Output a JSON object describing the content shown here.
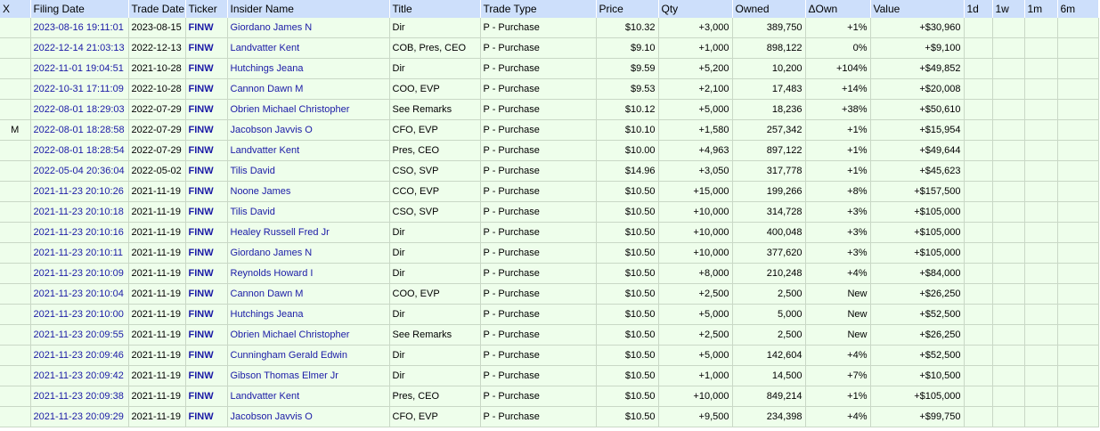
{
  "headers": {
    "x": "X",
    "filing_date": "Filing Date",
    "trade_date": "Trade Date",
    "ticker": "Ticker",
    "insider_name": "Insider Name",
    "title": "Title",
    "trade_type": "Trade Type",
    "price": "Price",
    "qty": "Qty",
    "owned": "Owned",
    "own_change": "ΔOwn",
    "value": "Value",
    "d1": "1d",
    "w1": "1w",
    "m1": "1m",
    "m6": "6m"
  },
  "rows": [
    {
      "x": "",
      "filing": "2023-08-16 19:11:01",
      "trade": "2023-08-15",
      "ticker": "FINW",
      "name": "Giordano James N",
      "title": "Dir",
      "type": "P - Purchase",
      "price": "$10.32",
      "qty": "+3,000",
      "owned": "389,750",
      "own": "+1%",
      "value": "+$30,960"
    },
    {
      "x": "",
      "filing": "2022-12-14 21:03:13",
      "trade": "2022-12-13",
      "ticker": "FINW",
      "name": "Landvatter Kent",
      "title": "COB, Pres, CEO",
      "type": "P - Purchase",
      "price": "$9.10",
      "qty": "+1,000",
      "owned": "898,122",
      "own": "0%",
      "value": "+$9,100"
    },
    {
      "x": "",
      "filing": "2022-11-01 19:04:51",
      "trade": "2021-10-28",
      "ticker": "FINW",
      "name": "Hutchings Jeana",
      "title": "Dir",
      "type": "P - Purchase",
      "price": "$9.59",
      "qty": "+5,200",
      "owned": "10,200",
      "own": "+104%",
      "value": "+$49,852"
    },
    {
      "x": "",
      "filing": "2022-10-31 17:11:09",
      "trade": "2022-10-28",
      "ticker": "FINW",
      "name": "Cannon Dawn M",
      "title": "COO, EVP",
      "type": "P - Purchase",
      "price": "$9.53",
      "qty": "+2,100",
      "owned": "17,483",
      "own": "+14%",
      "value": "+$20,008"
    },
    {
      "x": "",
      "filing": "2022-08-01 18:29:03",
      "trade": "2022-07-29",
      "ticker": "FINW",
      "name": "Obrien Michael Christopher",
      "title": "See Remarks",
      "type": "P - Purchase",
      "price": "$10.12",
      "qty": "+5,000",
      "owned": "18,236",
      "own": "+38%",
      "value": "+$50,610"
    },
    {
      "x": "M",
      "filing": "2022-08-01 18:28:58",
      "trade": "2022-07-29",
      "ticker": "FINW",
      "name": "Jacobson Javvis O",
      "title": "CFO, EVP",
      "type": "P - Purchase",
      "price": "$10.10",
      "qty": "+1,580",
      "owned": "257,342",
      "own": "+1%",
      "value": "+$15,954"
    },
    {
      "x": "",
      "filing": "2022-08-01 18:28:54",
      "trade": "2022-07-29",
      "ticker": "FINW",
      "name": "Landvatter Kent",
      "title": "Pres, CEO",
      "type": "P - Purchase",
      "price": "$10.00",
      "qty": "+4,963",
      "owned": "897,122",
      "own": "+1%",
      "value": "+$49,644"
    },
    {
      "x": "",
      "filing": "2022-05-04 20:36:04",
      "trade": "2022-05-02",
      "ticker": "FINW",
      "name": "Tilis David",
      "title": "CSO, SVP",
      "type": "P - Purchase",
      "price": "$14.96",
      "qty": "+3,050",
      "owned": "317,778",
      "own": "+1%",
      "value": "+$45,623"
    },
    {
      "x": "",
      "filing": "2021-11-23 20:10:26",
      "trade": "2021-11-19",
      "ticker": "FINW",
      "name": "Noone James",
      "title": "CCO, EVP",
      "type": "P - Purchase",
      "price": "$10.50",
      "qty": "+15,000",
      "owned": "199,266",
      "own": "+8%",
      "value": "+$157,500"
    },
    {
      "x": "",
      "filing": "2021-11-23 20:10:18",
      "trade": "2021-11-19",
      "ticker": "FINW",
      "name": "Tilis David",
      "title": "CSO, SVP",
      "type": "P - Purchase",
      "price": "$10.50",
      "qty": "+10,000",
      "owned": "314,728",
      "own": "+3%",
      "value": "+$105,000"
    },
    {
      "x": "",
      "filing": "2021-11-23 20:10:16",
      "trade": "2021-11-19",
      "ticker": "FINW",
      "name": "Healey Russell Fred Jr",
      "title": "Dir",
      "type": "P - Purchase",
      "price": "$10.50",
      "qty": "+10,000",
      "owned": "400,048",
      "own": "+3%",
      "value": "+$105,000"
    },
    {
      "x": "",
      "filing": "2021-11-23 20:10:11",
      "trade": "2021-11-19",
      "ticker": "FINW",
      "name": "Giordano James N",
      "title": "Dir",
      "type": "P - Purchase",
      "price": "$10.50",
      "qty": "+10,000",
      "owned": "377,620",
      "own": "+3%",
      "value": "+$105,000"
    },
    {
      "x": "",
      "filing": "2021-11-23 20:10:09",
      "trade": "2021-11-19",
      "ticker": "FINW",
      "name": "Reynolds Howard I",
      "title": "Dir",
      "type": "P - Purchase",
      "price": "$10.50",
      "qty": "+8,000",
      "owned": "210,248",
      "own": "+4%",
      "value": "+$84,000"
    },
    {
      "x": "",
      "filing": "2021-11-23 20:10:04",
      "trade": "2021-11-19",
      "ticker": "FINW",
      "name": "Cannon Dawn M",
      "title": "COO, EVP",
      "type": "P - Purchase",
      "price": "$10.50",
      "qty": "+2,500",
      "owned": "2,500",
      "own": "New",
      "value": "+$26,250"
    },
    {
      "x": "",
      "filing": "2021-11-23 20:10:00",
      "trade": "2021-11-19",
      "ticker": "FINW",
      "name": "Hutchings Jeana",
      "title": "Dir",
      "type": "P - Purchase",
      "price": "$10.50",
      "qty": "+5,000",
      "owned": "5,000",
      "own": "New",
      "value": "+$52,500"
    },
    {
      "x": "",
      "filing": "2021-11-23 20:09:55",
      "trade": "2021-11-19",
      "ticker": "FINW",
      "name": "Obrien Michael Christopher",
      "title": "See Remarks",
      "type": "P - Purchase",
      "price": "$10.50",
      "qty": "+2,500",
      "owned": "2,500",
      "own": "New",
      "value": "+$26,250"
    },
    {
      "x": "",
      "filing": "2021-11-23 20:09:46",
      "trade": "2021-11-19",
      "ticker": "FINW",
      "name": "Cunningham Gerald Edwin",
      "title": "Dir",
      "type": "P - Purchase",
      "price": "$10.50",
      "qty": "+5,000",
      "owned": "142,604",
      "own": "+4%",
      "value": "+$52,500"
    },
    {
      "x": "",
      "filing": "2021-11-23 20:09:42",
      "trade": "2021-11-19",
      "ticker": "FINW",
      "name": "Gibson Thomas Elmer Jr",
      "title": "Dir",
      "type": "P - Purchase",
      "price": "$10.50",
      "qty": "+1,000",
      "owned": "14,500",
      "own": "+7%",
      "value": "+$10,500"
    },
    {
      "x": "",
      "filing": "2021-11-23 20:09:38",
      "trade": "2021-11-19",
      "ticker": "FINW",
      "name": "Landvatter Kent",
      "title": "Pres, CEO",
      "type": "P - Purchase",
      "price": "$10.50",
      "qty": "+10,000",
      "owned": "849,214",
      "own": "+1%",
      "value": "+$105,000"
    },
    {
      "x": "",
      "filing": "2021-11-23 20:09:29",
      "trade": "2021-11-19",
      "ticker": "FINW",
      "name": "Jacobson Javvis O",
      "title": "CFO, EVP",
      "type": "P - Purchase",
      "price": "$10.50",
      "qty": "+9,500",
      "owned": "234,398",
      "own": "+4%",
      "value": "+$99,750"
    }
  ]
}
